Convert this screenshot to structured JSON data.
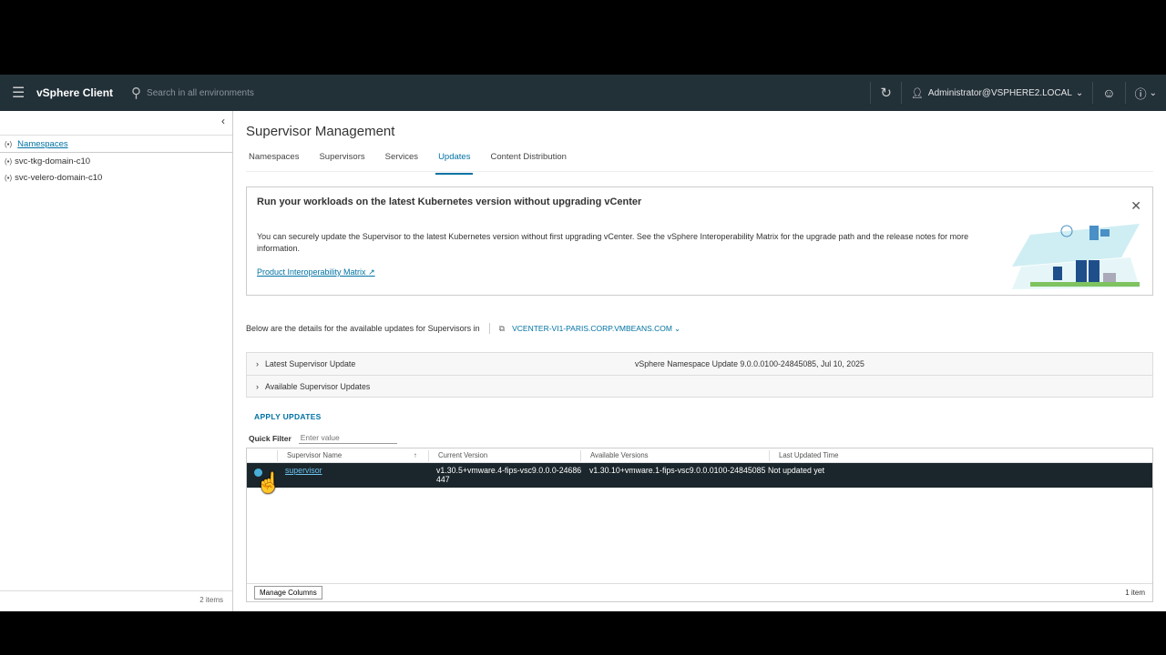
{
  "header": {
    "app_name": "vSphere Client",
    "search_placeholder": "Search in all environments",
    "user": "Administrator@VSPHERE2.LOCAL"
  },
  "sidebar": {
    "items": [
      {
        "label": "Namespaces"
      },
      {
        "label": "svc-tkg-domain-c10"
      },
      {
        "label": "svc-velero-domain-c10"
      }
    ],
    "count": "2 items"
  },
  "main": {
    "title": "Supervisor Management",
    "tabs": [
      {
        "label": "Namespaces"
      },
      {
        "label": "Supervisors"
      },
      {
        "label": "Services"
      },
      {
        "label": "Updates"
      },
      {
        "label": "Content Distribution"
      }
    ],
    "banner": {
      "title": "Run your workloads on the latest Kubernetes version without upgrading vCenter",
      "body": "You can securely update the Supervisor to the latest Kubernetes version without first upgrading vCenter. See the vSphere Interoperability Matrix for the upgrade path and the release notes for more information.",
      "link": "Product Interoperability Matrix"
    },
    "details_text": "Below are the details for the available updates for Supervisors in",
    "vcenter": "VCENTER-VI1-PARIS.CORP.VMBEANS.COM",
    "accordion": [
      {
        "label": "Latest Supervisor Update",
        "value": "vSphere Namespace Update 9.0.0.0100-24845085, Jul 10, 2025"
      },
      {
        "label": "Available Supervisor Updates"
      }
    ],
    "apply_label": "APPLY UPDATES",
    "quick_filter_label": "Quick Filter",
    "quick_filter_placeholder": "Enter value",
    "grid": {
      "columns": [
        "Supervisor Name",
        "Current Version",
        "Available Versions",
        "Last Updated Time"
      ],
      "rows": [
        {
          "name": "supervisor",
          "current": "v1.30.5+vmware.4-fips-vsc9.0.0.0-24686447",
          "available": "v1.30.10+vmware.1-fips-vsc9.0.0.0100-24845085",
          "updated": "Not updated yet"
        }
      ],
      "manage_columns": "Manage Columns",
      "count": "1 item"
    }
  }
}
